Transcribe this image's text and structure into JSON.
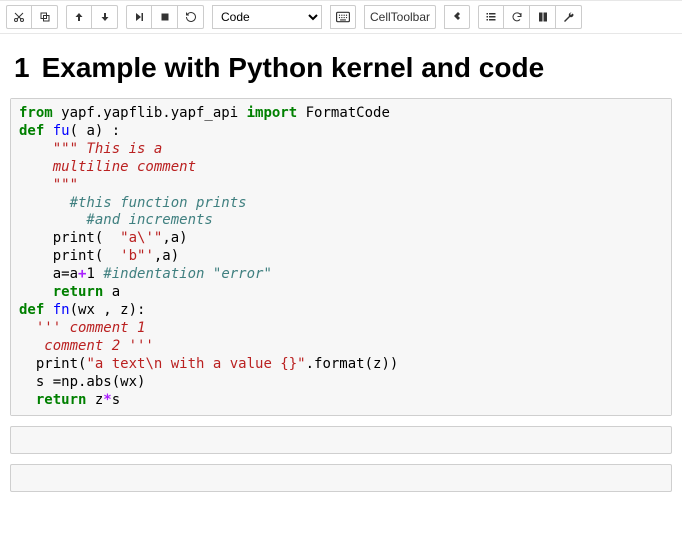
{
  "toolbar": {
    "cell_type_selected": "Code",
    "cell_toolbar_label": "CellToolbar"
  },
  "heading": {
    "num": "1",
    "text": "Example with Python kernel and code"
  },
  "code": {
    "l1_from": "from",
    "l1_mod": " yapf.yapflib.yapf_api ",
    "l1_import": "import",
    "l1_name": " FormatCode",
    "l2_def": "def",
    "l2_name": " fu",
    "l2_rest": "( a) :",
    "l3": "    \"\"\" This is a",
    "l4": "    multiline comment",
    "l5": "    \"\"\"",
    "l6": "      #this function prints",
    "l7": "        #and increments",
    "l8a": "    print(  ",
    "l8b": "\"a\\'\"",
    "l8c": ",a)",
    "l9a": "    print(  ",
    "l9b": "'b\"'",
    "l9c": ",a)",
    "l10a": "    a=a",
    "l10b": "+",
    "l10c": "1 ",
    "l10d": "#indentation \"error\"",
    "l11a": "    ",
    "l11b": "return",
    "l11c": " a",
    "l12_def": "def",
    "l12_name": " fn",
    "l12_rest": "(wx , z):",
    "l13": "  ''' comment 1",
    "l14": "   comment 2 '''",
    "l15a": "  print(",
    "l15b": "\"a text\\n with a value {}\"",
    "l15c": ".format(z))",
    "l16": "  s =np.abs(wx)",
    "l17a": "  ",
    "l17b": "return",
    "l17c": " z",
    "l17d": "*",
    "l17e": "s"
  }
}
